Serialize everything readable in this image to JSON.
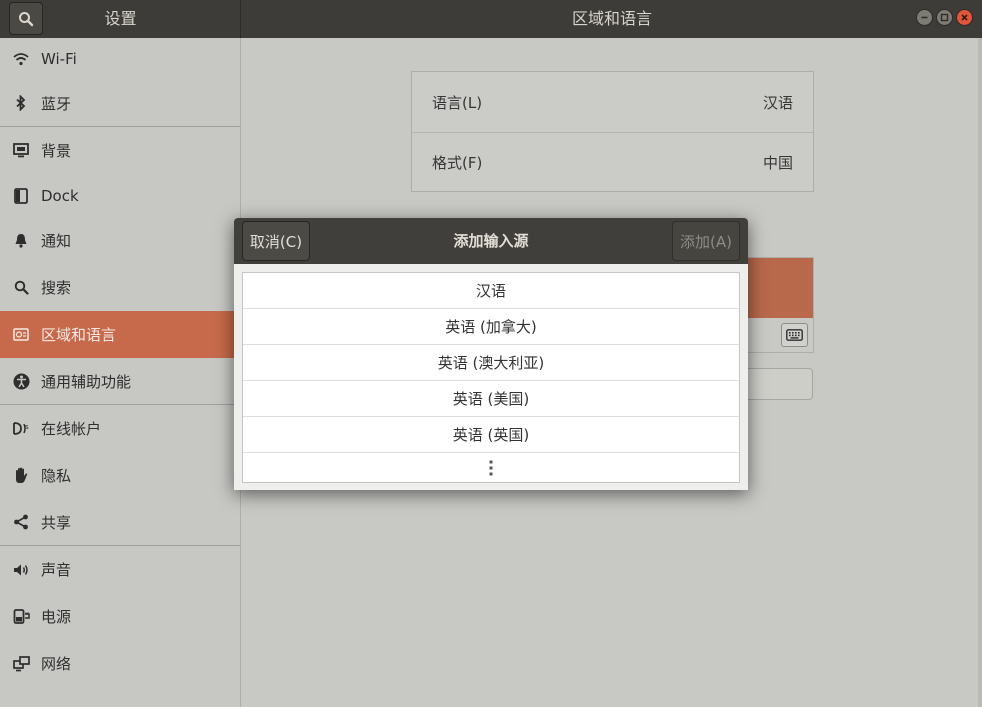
{
  "header": {
    "sidebar_title": "设置",
    "main_title": "区域和语言"
  },
  "sidebar": {
    "items": [
      {
        "label": "Wi-Fi",
        "icon": "wifi-icon"
      },
      {
        "label": "蓝牙",
        "icon": "bluetooth-icon"
      },
      {
        "label": "背景",
        "icon": "background-icon"
      },
      {
        "label": "Dock",
        "icon": "dock-icon"
      },
      {
        "label": "通知",
        "icon": "bell-icon"
      },
      {
        "label": "搜索",
        "icon": "search-icon"
      },
      {
        "label": "区域和语言",
        "icon": "region-language-icon"
      },
      {
        "label": "通用辅助功能",
        "icon": "accessibility-icon"
      },
      {
        "label": "在线帐户",
        "icon": "online-accounts-icon"
      },
      {
        "label": "隐私",
        "icon": "privacy-hand-icon"
      },
      {
        "label": "共享",
        "icon": "share-icon"
      },
      {
        "label": "声音",
        "icon": "speaker-icon"
      },
      {
        "label": "电源",
        "icon": "power-icon"
      },
      {
        "label": "网络",
        "icon": "network-icon"
      }
    ]
  },
  "main": {
    "language_label": "语言(L)",
    "language_value": "汉语",
    "formats_label": "格式(F)",
    "formats_value": "中国"
  },
  "dialog": {
    "title": "添加输入源",
    "cancel_label": "取消(C)",
    "add_label": "添加(A)",
    "options": [
      "汉语",
      "英语 (加拿大)",
      "英语 (澳大利亚)",
      "英语 (美国)",
      "英语 (英国)"
    ]
  },
  "colors": {
    "accent": "#c76a4b",
    "headerbar": "#3d3c38"
  }
}
